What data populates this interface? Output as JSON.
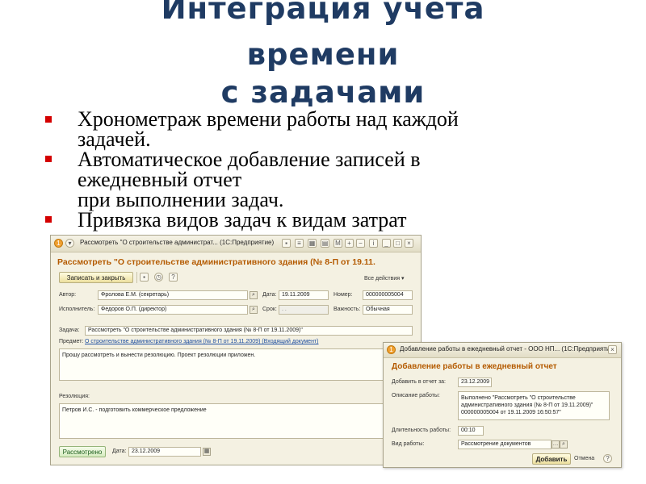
{
  "slide": {
    "title_lines": [
      "Интеграция учета",
      "времени",
      "с задачами"
    ],
    "bullets": [
      "Хронометраж времени работы над каждой\nзадачей.",
      "Автоматическое добавление записей в\nежедневный отчет\nпри выполнении задач.",
      "Привязка видов задач к видам затрат"
    ],
    "colors": {
      "title": "#1f3b63",
      "bullet": "#d40000",
      "doc_title": "#b45a00",
      "link": "#1f4fa0"
    }
  },
  "window_task": {
    "title": "Рассмотреть \"О строительстве администрат... (1С:Предприятие)",
    "doc_title": "Рассмотреть \"О строительстве административного здания (№ 8-П от 19.11.",
    "toolbar": {
      "save_close": "Записать и закрыть",
      "all_actions": "Все действия ▾"
    },
    "author_label": "Автор:",
    "author_value": "Фролова Е.М. (секретарь)",
    "date_label": "Дата:",
    "date_value": "19.11.2009",
    "number_label": "Номер:",
    "number_value": "000000005004",
    "executor_label": "Исполнитель:",
    "executor_value": "Федоров О.П. (директор)",
    "term_label": "Срок:",
    "term_value": " .  .",
    "importance_label": "Важность:",
    "importance_value": "Обычная",
    "task_label": "Задача:",
    "task_value": "Рассмотреть \"О строительстве административного здания (№ 8-П от 19.11.2009)\"",
    "subject_label": "Предмет:",
    "subject_link": "О строительстве административного здания (№ 8-П от 19.11.2009) (Входящий документ)",
    "description": "Прошу рассмотреть и вынести резолюцию. Проект резолюции приложен.",
    "resolution_label": "Резолюция:",
    "resolution_value": "Петров И.С. - подготовить коммерческое предложение",
    "reviewed_button": "Рассмотрено",
    "bottom_date_label": "Дата:",
    "bottom_date_value": "23.12.2009"
  },
  "window_report": {
    "title": "Добавление работы в ежедневный отчет - ООО НП... (1С:Предприятие)",
    "doc_title": "Добавление работы в ежедневный отчет",
    "add_to_report_label": "Добавить в отчет за:",
    "add_to_report_value": "23.12.2009",
    "work_desc_label": "Описание работы:",
    "work_desc_value": "Выполнено \"Рассмотреть \"О строительстве административного здания (№ 8-П от 19.11.2009)\" 000000005004 от 19.11.2009 16:50:57\"",
    "duration_label": "Длительность работы:",
    "duration_value": "00:10",
    "work_type_label": "Вид работы:",
    "work_type_value": "Рассмотрение документов",
    "add_button": "Добавить",
    "cancel_button": "Отмена"
  }
}
